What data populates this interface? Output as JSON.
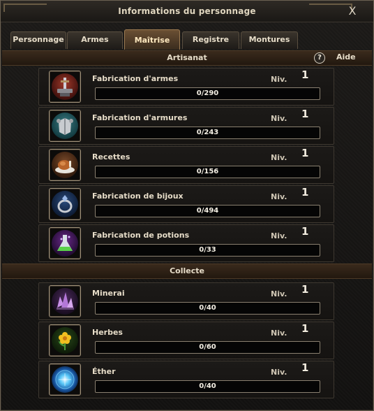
{
  "window": {
    "title": "Informations du personnage",
    "close_glyph": "X"
  },
  "tabs": [
    {
      "label": "Personnage",
      "active": false
    },
    {
      "label": "Armes",
      "active": false
    },
    {
      "label": "Maîtrise",
      "active": true
    },
    {
      "label": "Registre",
      "active": false
    },
    {
      "label": "Montures",
      "active": false
    }
  ],
  "help": {
    "icon": "?",
    "label": "Aide"
  },
  "sections": [
    {
      "title": "Artisanat",
      "skills": [
        {
          "name": "Fabrication d'armes",
          "level_label": "Niv.",
          "level": "1",
          "progress_text": "0/290",
          "progress": 0,
          "icon": "weaponsmithing-icon"
        },
        {
          "name": "Fabrication d'armures",
          "level_label": "Niv.",
          "level": "1",
          "progress_text": "0/243",
          "progress": 0,
          "icon": "armorsmithing-icon"
        },
        {
          "name": "Recettes",
          "level_label": "Niv.",
          "level": "1",
          "progress_text": "0/156",
          "progress": 0,
          "icon": "cooking-icon"
        },
        {
          "name": "Fabrication de bijoux",
          "level_label": "Niv.",
          "level": "1",
          "progress_text": "0/494",
          "progress": 0,
          "icon": "jewelry-icon"
        },
        {
          "name": "Fabrication de potions",
          "level_label": "Niv.",
          "level": "1",
          "progress_text": "0/33",
          "progress": 0,
          "icon": "alchemy-icon"
        }
      ]
    },
    {
      "title": "Collecte",
      "skills": [
        {
          "name": "Minerai",
          "level_label": "Niv.",
          "level": "1",
          "progress_text": "0/40",
          "progress": 0,
          "icon": "ore-icon"
        },
        {
          "name": "Herbes",
          "level_label": "Niv.",
          "level": "1",
          "progress_text": "0/60",
          "progress": 0,
          "icon": "herb-icon"
        },
        {
          "name": "Éther",
          "level_label": "Niv.",
          "level": "1",
          "progress_text": "0/40",
          "progress": 0,
          "icon": "aether-icon"
        }
      ]
    }
  ],
  "colors": {
    "section_header": "#3a2a1c",
    "active_tab": "#6a4f33",
    "progress_fill": "#6a8a3a"
  }
}
